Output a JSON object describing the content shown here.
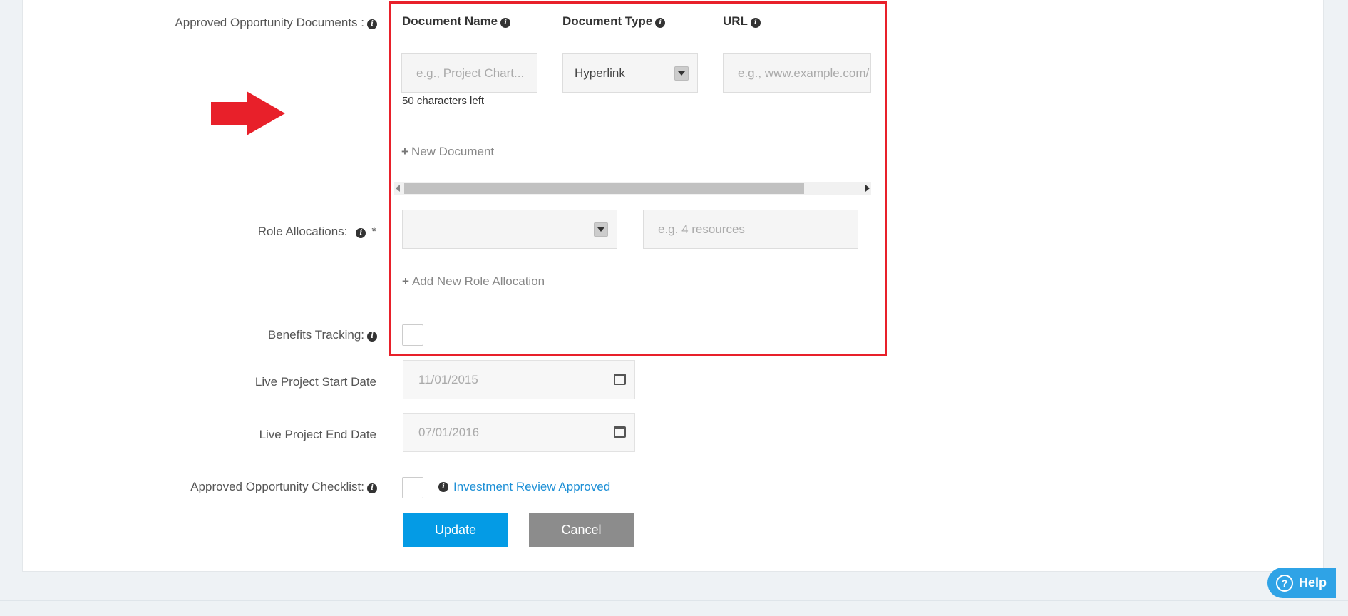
{
  "form": {
    "approved_docs_label": "Approved Opportunity Documents :",
    "role_alloc_label": "Role Allocations:",
    "required_mark": "*",
    "benefits_label": "Benefits Tracking:",
    "start_date_label": "Live Project Start Date",
    "end_date_label": "Live Project End Date",
    "checklist_label": "Approved Opportunity Checklist:"
  },
  "documents": {
    "col_name": "Document Name",
    "col_type": "Document Type",
    "col_url": "URL",
    "name_placeholder": "e.g., Project Chart...",
    "type_value": "Hyperlink",
    "url_placeholder": "e.g., www.example.com/",
    "chars_left": "50 characters left",
    "new_document": "New Document"
  },
  "roles": {
    "resources_placeholder": "e.g. 4 resources",
    "add_new": "Add New Role Allocation"
  },
  "dates": {
    "start": "11/01/2015",
    "end": "07/01/2016"
  },
  "checklist": {
    "review_link": "Investment Review Approved"
  },
  "buttons": {
    "update": "Update",
    "cancel": "Cancel",
    "help": "Help"
  },
  "icons": {
    "info": "info-icon",
    "plus": "plus-icon",
    "calendar": "calendar-icon",
    "help": "question-circle-icon",
    "annotation": "red-arrow-icon"
  },
  "colors": {
    "highlight": "#e8202a",
    "primary": "#049be5",
    "link": "#1e90d6"
  }
}
